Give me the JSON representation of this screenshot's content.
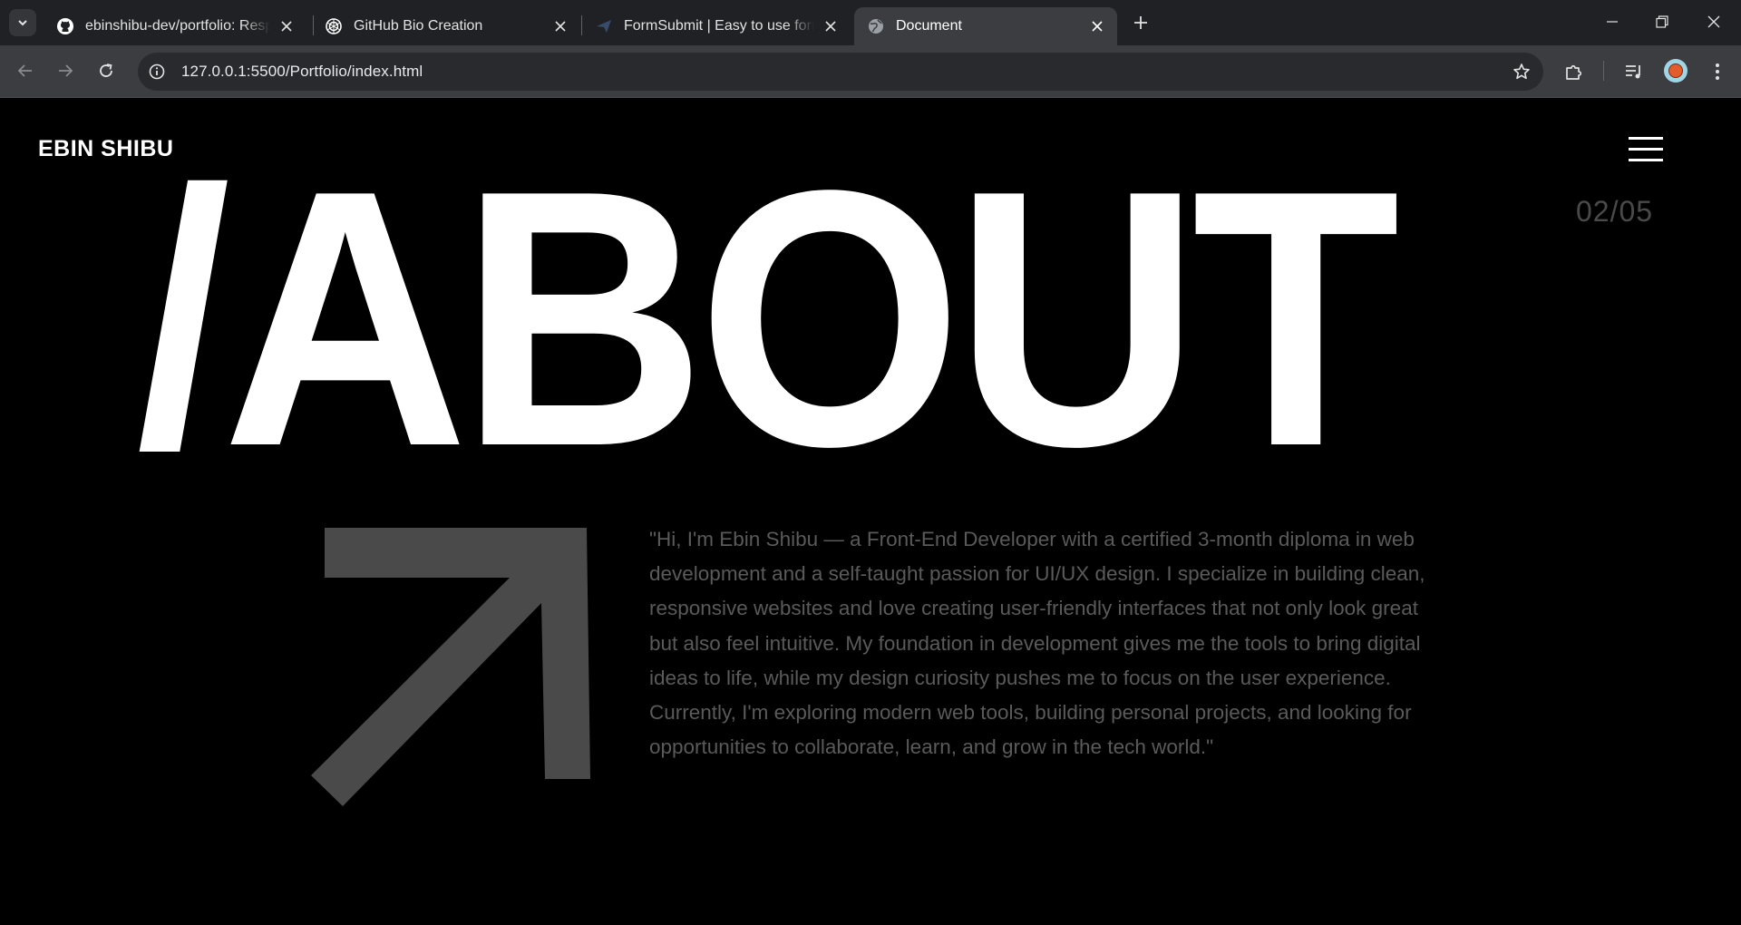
{
  "browser": {
    "tabs": [
      {
        "title": "ebinshibu-dev/portfolio: Respon",
        "favicon": "github-icon",
        "active": false
      },
      {
        "title": "GitHub Bio Creation",
        "favicon": "chatgpt-icon",
        "active": false
      },
      {
        "title": "FormSubmit | Easy to use form",
        "favicon": "formsubmit-icon",
        "active": false
      },
      {
        "title": "Document",
        "favicon": "globe-icon",
        "active": true
      }
    ],
    "url": "127.0.0.1:5500/Portfolio/index.html"
  },
  "page": {
    "brand": "EBIN SHIBU",
    "hero_title": "/ABOUT",
    "section_counter": "02/05",
    "about_text": "\"Hi, I'm Ebin Shibu — a Front-End Developer with a certified 3-month diploma in web development and a self-taught passion for UI/UX design. I specialize in building clean, responsive websites and love creating user-friendly interfaces that not only look great but also feel intuitive. My foundation in development gives me the tools to bring digital ideas to life, while my design curiosity pushes me to focus on the user experience. Currently, I'm exploring modern web tools, building personal projects, and looking for opportunities to collaborate, learn, and grow in the tech world.\""
  },
  "colors": {
    "background": "#000000",
    "heading": "#ffffff",
    "muted_text": "#5a5a5a",
    "arrow": "#4a4a4a",
    "chrome_tabstrip": "#202124",
    "chrome_toolbar": "#3c3d41"
  }
}
